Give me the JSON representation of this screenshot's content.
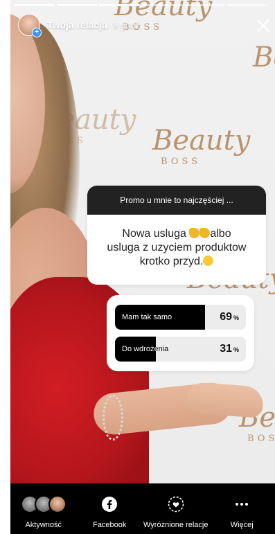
{
  "header": {
    "title": "Twoja relacja",
    "time": "9 godz."
  },
  "question": {
    "prompt": "Promo u mnie to najczęściej ...",
    "answer_line1": "Nowa usluga",
    "answer_line1_tail": "albo",
    "answer_line2": "usluga z uzyciem produktow",
    "answer_line3": "krotko przyd."
  },
  "poll": {
    "options": [
      {
        "label": "Mam tak samo",
        "percent": 69,
        "percent_text": "69",
        "unit": "%"
      },
      {
        "label": "Do wdrożenia",
        "percent": 31,
        "percent_text": "31",
        "unit": "%"
      }
    ]
  },
  "background": {
    "brand_script": "Beauty",
    "brand_sub": "BOSS"
  },
  "bottom_bar": {
    "items": [
      {
        "label": "Aktywność",
        "icon": "viewers-avatars-icon"
      },
      {
        "label": "Facebook",
        "icon": "facebook-icon"
      },
      {
        "label": "Wyróżnione relacje",
        "icon": "highlight-heart-icon"
      },
      {
        "label": "Więcej",
        "icon": "more-dots-icon"
      }
    ]
  },
  "colors": {
    "dress": "#c4161d",
    "brand_gold": "#b48a60",
    "poll_fill": "#000000",
    "accent_blue": "#3897f0"
  }
}
